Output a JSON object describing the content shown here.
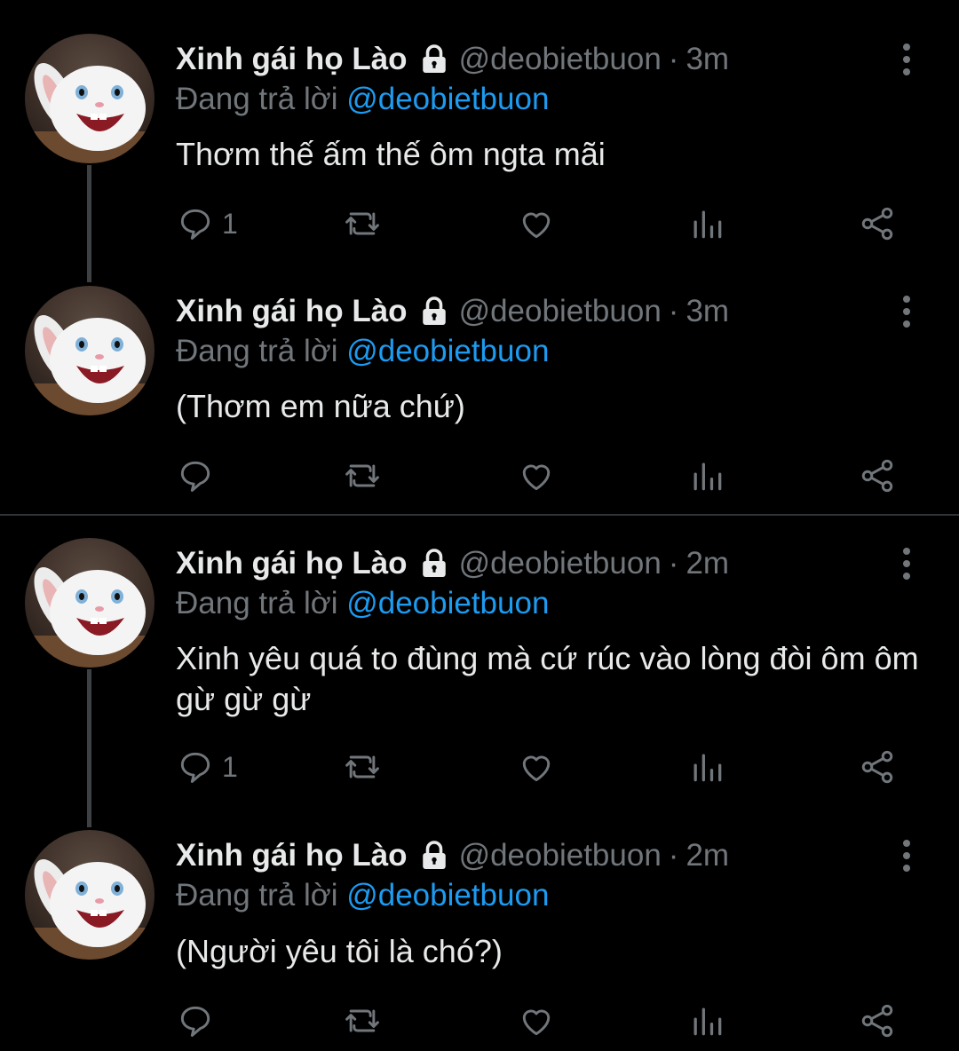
{
  "tweets": [
    {
      "name": "Xinh gái họ Lào",
      "handle": "@deobietbuon",
      "separator": "·",
      "time": "3m",
      "reply_prefix": "Đang trả lời",
      "reply_to": "@deobietbuon",
      "text": "Thơm thế ấm thế ôm ngta mãi",
      "reply_count": "1"
    },
    {
      "name": "Xinh gái họ Lào",
      "handle": "@deobietbuon",
      "separator": "·",
      "time": "3m",
      "reply_prefix": "Đang trả lời",
      "reply_to": "@deobietbuon",
      "text": "(Thơm em nữa chứ)",
      "reply_count": ""
    },
    {
      "name": "Xinh gái họ Lào",
      "handle": "@deobietbuon",
      "separator": "·",
      "time": "2m",
      "reply_prefix": "Đang trả lời",
      "reply_to": "@deobietbuon",
      "text": "Xinh yêu quá to đùng mà cứ rúc vào lòng đòi ôm ôm gừ gừ gừ",
      "reply_count": "1"
    },
    {
      "name": "Xinh gái họ Lào",
      "handle": "@deobietbuon",
      "separator": "·",
      "time": "2m",
      "reply_prefix": "Đang trả lời",
      "reply_to": "@deobietbuon",
      "text": "(Người yêu tôi là chó?)",
      "reply_count": ""
    }
  ],
  "icons": {
    "lock": "lock-icon",
    "reply": "reply-icon",
    "retweet": "retweet-icon",
    "like": "heart-icon",
    "views": "analytics-icon",
    "share": "share-icon",
    "more": "more-vertical-icon"
  },
  "colors": {
    "background": "#000000",
    "text": "#e7e9ea",
    "muted": "#71767b",
    "mention": "#1d9bf0",
    "divider": "#2f3336"
  }
}
